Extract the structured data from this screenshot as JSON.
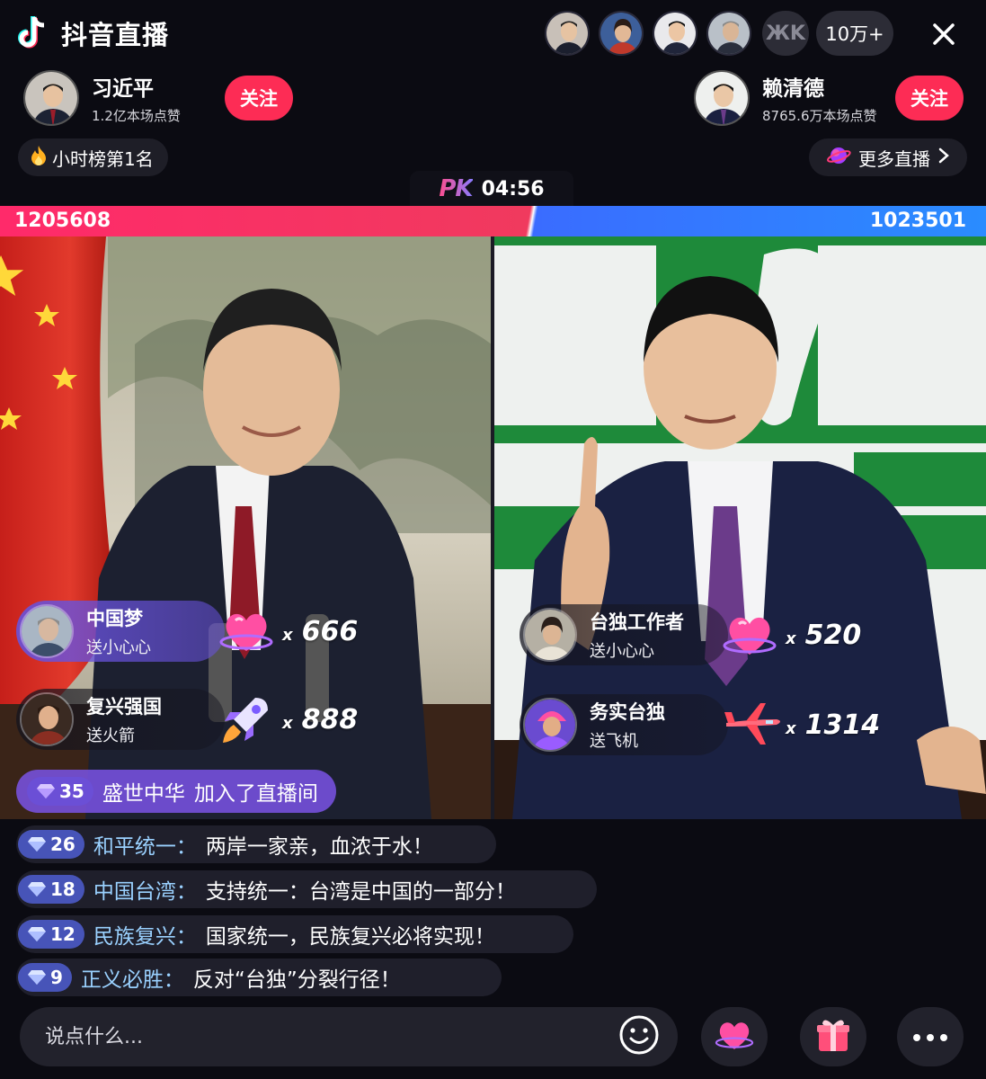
{
  "app": {
    "title": "抖音直播"
  },
  "viewers": {
    "count": "10万+",
    "more_label": "ЖK"
  },
  "hosts": {
    "left": {
      "name": "习近平",
      "likes": "1.2亿本场点赞",
      "follow_label": "关注"
    },
    "right": {
      "name": "赖清德",
      "likes": "8765.6万本场点赞",
      "follow_label": "关注"
    }
  },
  "rank": {
    "label": "小时榜第1名"
  },
  "more_live": {
    "label": "更多直播"
  },
  "pk": {
    "logo": "PK",
    "timer": "04:56",
    "score_left": "1205608",
    "score_right": "1023501",
    "left_fraction": 0.5407
  },
  "gifts_left": [
    {
      "user": "中国梦",
      "action": "送小心心",
      "icon": "heart-gift-icon",
      "count": "666"
    },
    {
      "user": "复兴强国",
      "action": "送火箭",
      "icon": "rocket-gift-icon",
      "count": "888"
    }
  ],
  "gifts_right": [
    {
      "user": "台独工作者",
      "action": "送小心心",
      "icon": "heart-gift-icon",
      "count": "520"
    },
    {
      "user": "务实台独",
      "action": "送飞机",
      "icon": "airplane-gift-icon",
      "count": "1314"
    }
  ],
  "gift_x": "x",
  "join": {
    "level": "35",
    "user": "盛世中华",
    "text": "加入了直播间"
  },
  "comments": [
    {
      "level": "26",
      "user": "和平统一：",
      "text": "两岸一家亲，血浓于水！"
    },
    {
      "level": "18",
      "user": "中国台湾：",
      "text": "支持统一：台湾是中国的一部分！"
    },
    {
      "level": "12",
      "user": "民族复兴：",
      "text": "国家统一，民族复兴必将实现！"
    },
    {
      "level": "9",
      "user": "正义必胜：",
      "text": "反对“台独”分裂行径！"
    }
  ],
  "input": {
    "placeholder": "说点什么..."
  },
  "colors": {
    "accent": "#fd2c55",
    "red_team": "#f03a5e",
    "blue_team": "#3a6cff",
    "level_badge": "#4754b8"
  }
}
